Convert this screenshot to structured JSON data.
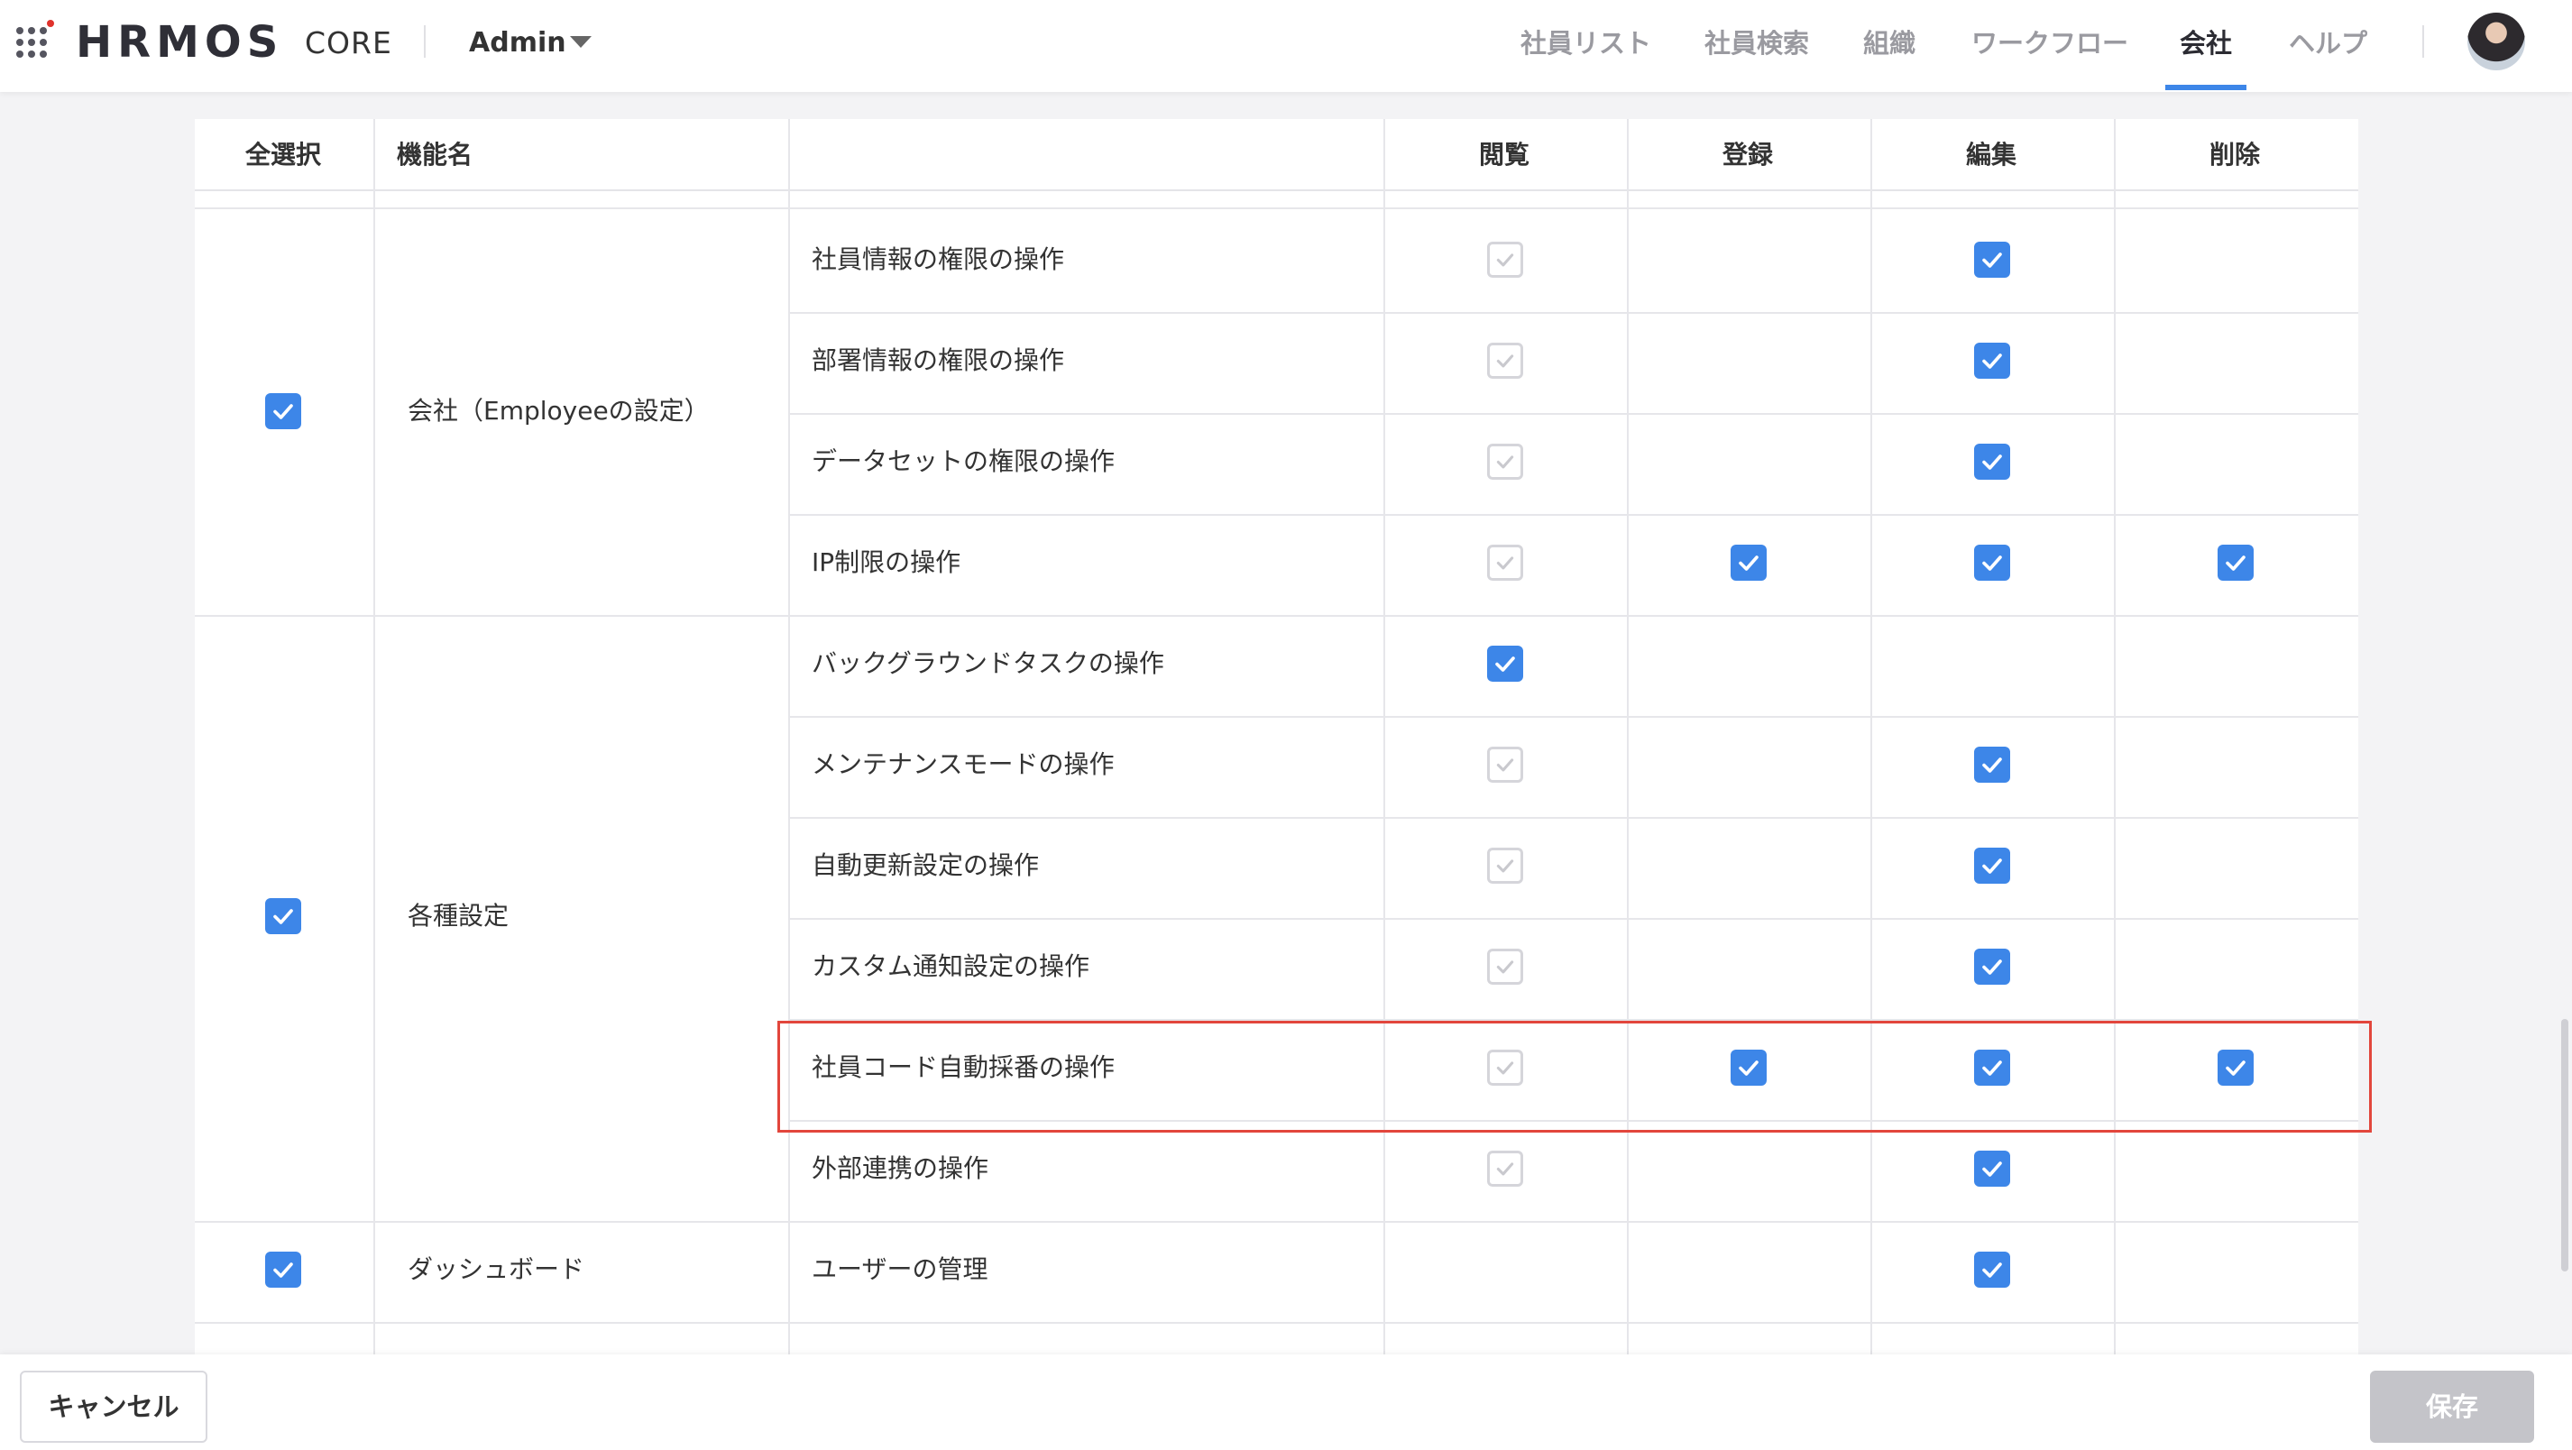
{
  "header": {
    "logo_text": "HRMOS",
    "logo_sub": "CORE",
    "workspace": "Admin",
    "nav": [
      {
        "label": "社員リスト",
        "active": false
      },
      {
        "label": "社員検索",
        "active": false
      },
      {
        "label": "組織",
        "active": false
      },
      {
        "label": "ワークフロー",
        "active": false
      },
      {
        "label": "会社",
        "active": true
      },
      {
        "label": "ヘルプ",
        "active": false
      }
    ]
  },
  "table": {
    "headers": {
      "select_all": "全選択",
      "feature_name": "機能名",
      "view": "閲覧",
      "register": "登録",
      "edit": "編集",
      "delete": "削除"
    },
    "groups": [
      {
        "name": "会社（Employeeの設定）",
        "selected": true,
        "rows": [
          {
            "feature": "社員情報の権限の操作",
            "view": "disabled",
            "register": "none",
            "edit": "checked",
            "delete": "none"
          },
          {
            "feature": "部署情報の権限の操作",
            "view": "disabled",
            "register": "none",
            "edit": "checked",
            "delete": "none"
          },
          {
            "feature": "データセットの権限の操作",
            "view": "disabled",
            "register": "none",
            "edit": "checked",
            "delete": "none"
          },
          {
            "feature": "IP制限の操作",
            "view": "disabled",
            "register": "checked",
            "edit": "checked",
            "delete": "checked"
          }
        ]
      },
      {
        "name": "各種設定",
        "selected": true,
        "rows": [
          {
            "feature": "バックグラウンドタスクの操作",
            "view": "checked",
            "register": "none",
            "edit": "none",
            "delete": "none"
          },
          {
            "feature": "メンテナンスモードの操作",
            "view": "disabled",
            "register": "none",
            "edit": "checked",
            "delete": "none"
          },
          {
            "feature": "自動更新設定の操作",
            "view": "disabled",
            "register": "none",
            "edit": "checked",
            "delete": "none"
          },
          {
            "feature": "カスタム通知設定の操作",
            "view": "disabled",
            "register": "none",
            "edit": "checked",
            "delete": "none"
          },
          {
            "feature": "社員コード自動採番の操作",
            "view": "disabled",
            "register": "checked",
            "edit": "checked",
            "delete": "checked",
            "highlighted": true
          },
          {
            "feature": "外部連携の操作",
            "view": "disabled",
            "register": "none",
            "edit": "checked",
            "delete": "none"
          }
        ]
      },
      {
        "name": "ダッシュボード",
        "selected": true,
        "rows": [
          {
            "feature": "ユーザーの管理",
            "view": "none",
            "register": "none",
            "edit": "checked",
            "delete": "none"
          }
        ]
      }
    ]
  },
  "footer": {
    "cancel_label": "キャンセル",
    "save_label": "保存"
  },
  "colors": {
    "accent": "#3d86e8",
    "highlight_border": "#e2463c",
    "disabled_border": "#d5d5da",
    "save_disabled": "#c4c4c9"
  }
}
